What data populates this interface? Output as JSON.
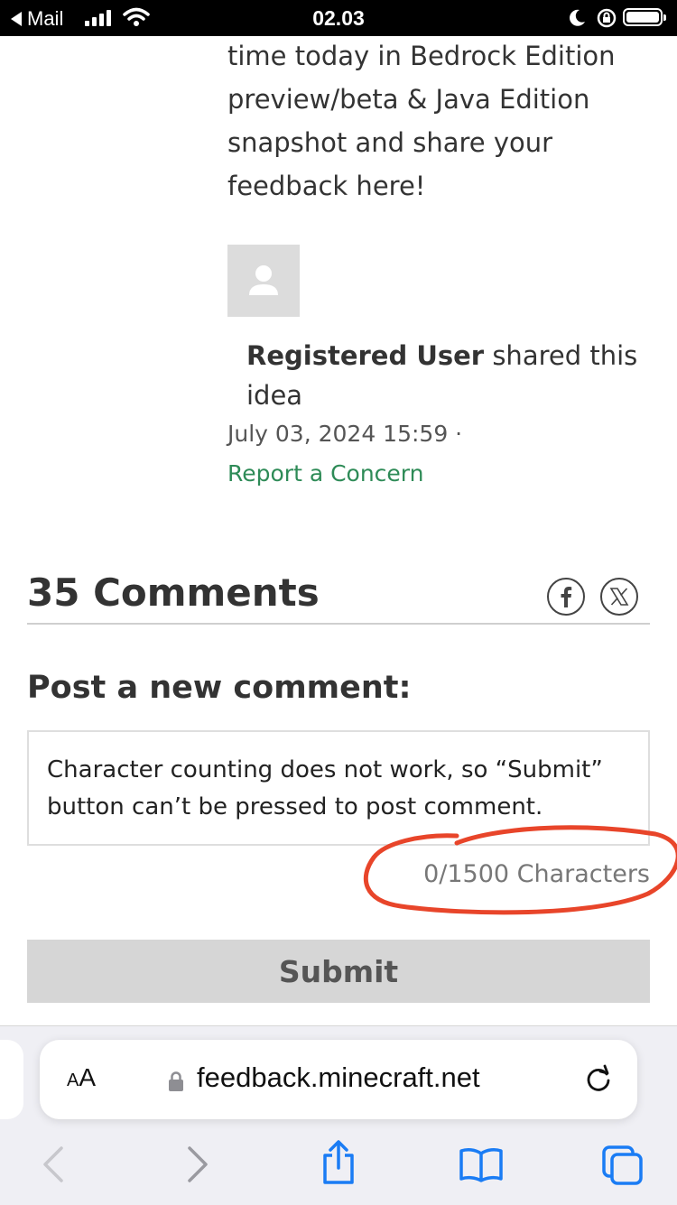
{
  "status_bar": {
    "back_app": "Mail",
    "time": "02.03"
  },
  "idea": {
    "text": "time today in Bedrock Edition preview/beta & Java Edition snapshot and share your feedback here!",
    "author_name": "Registered User",
    "author_action": "shared this idea",
    "date": "July 03, 2024 15:59 ·",
    "report_link": "Report a Concern"
  },
  "comments": {
    "title": "35 Comments",
    "share_icons": [
      "facebook-icon",
      "x-icon"
    ],
    "post_heading": "Post a new comment:",
    "input_value": "Character counting does not work, so “Submit” button can’t be pressed to post comment.",
    "char_count": "0/1500 Characters",
    "submit_label": "Submit"
  },
  "browser": {
    "text_size_button": "AA",
    "url": "feedback.minecraft.net"
  },
  "colors": {
    "link_green": "#2e8b57",
    "annotation_red": "#e8452a",
    "submit_bg": "#d6d6d6",
    "ios_blue": "#1a7cf4"
  }
}
